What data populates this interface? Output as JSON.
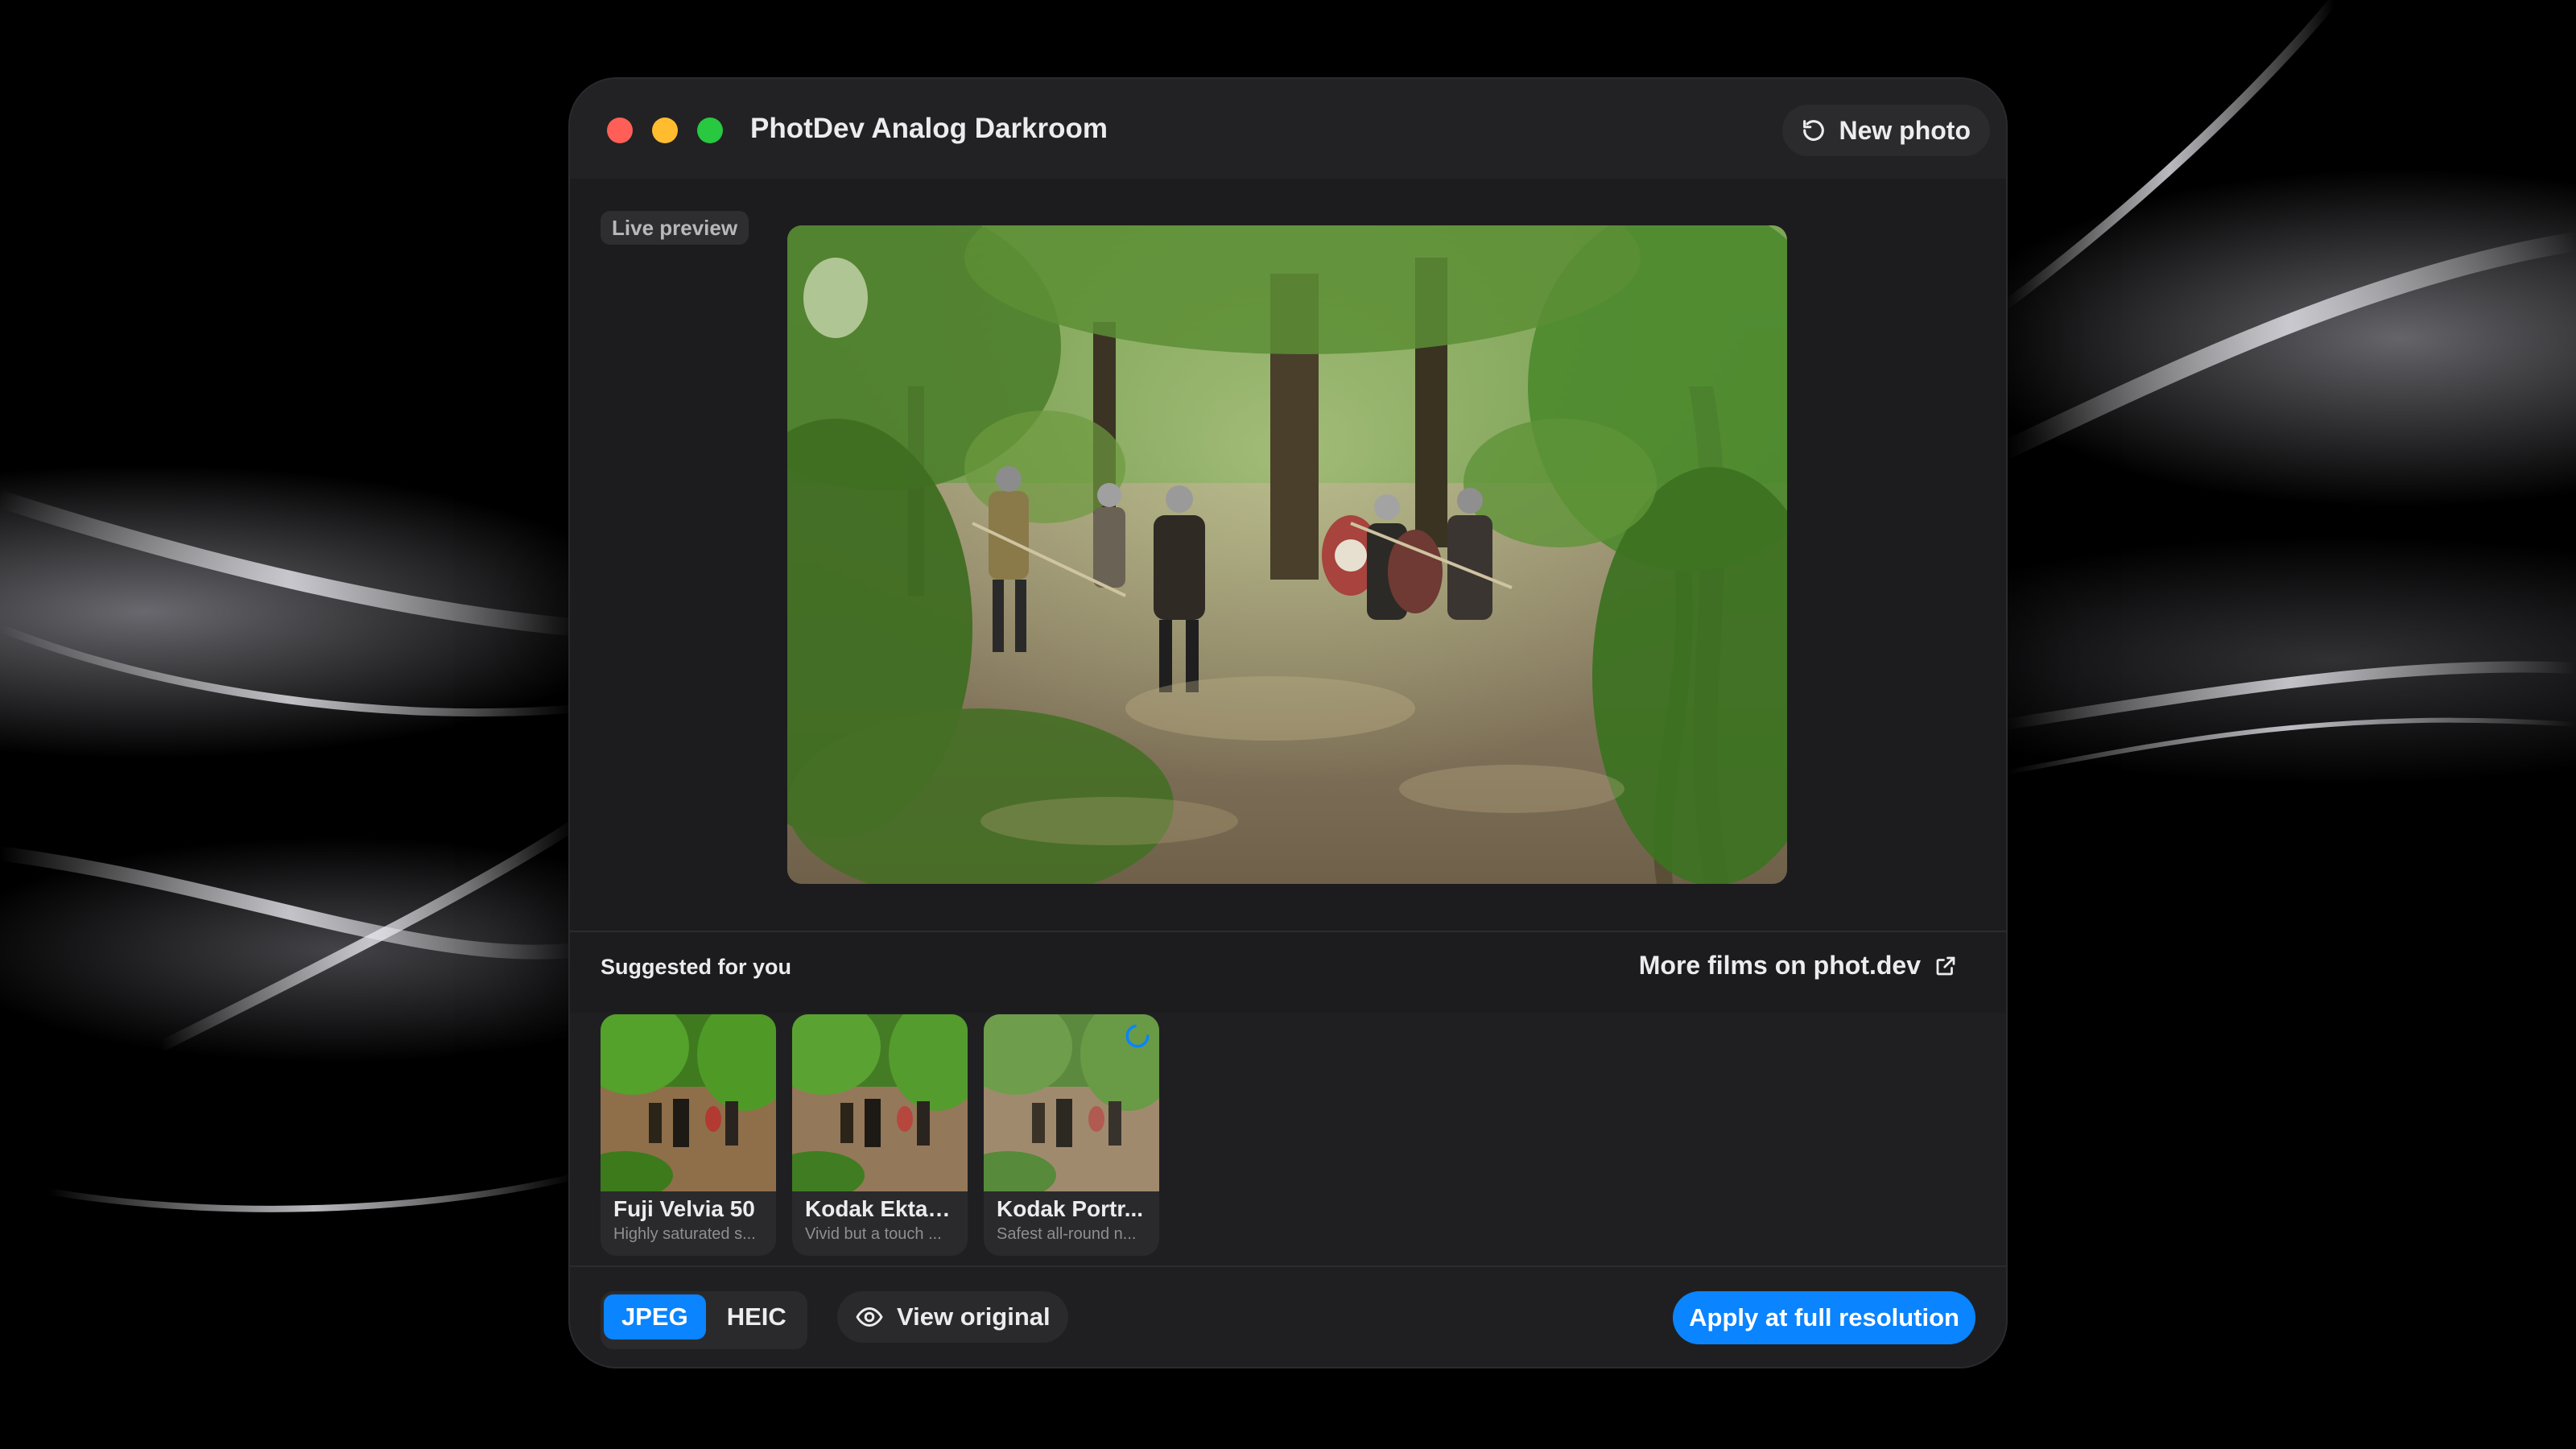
{
  "window": {
    "title": "PhotDev Analog Darkroom",
    "new_photo_label": "New photo",
    "traffic_lights": [
      "close",
      "minimize",
      "zoom"
    ]
  },
  "preview": {
    "badge": "Live preview"
  },
  "suggestions": {
    "heading": "Suggested for you",
    "more_link": "More films on phot.dev",
    "cards": [
      {
        "name": "Fuji Velvia 50",
        "desc": "Highly saturated s...",
        "loading": false
      },
      {
        "name": "Kodak Ektar ...",
        "desc": "Vivid but a touch ...",
        "loading": false
      },
      {
        "name": "Kodak Portr...",
        "desc": "Safest all-round n...",
        "loading": true
      }
    ]
  },
  "footer": {
    "formats": [
      {
        "label": "JPEG",
        "active": true
      },
      {
        "label": "HEIC",
        "active": false
      }
    ],
    "view_original": "View original",
    "apply": "Apply at full resolution"
  },
  "colors": {
    "accent": "#0a84ff",
    "window_bg": "#1f1f22",
    "close": "#ff5f57",
    "minimize": "#febc2e",
    "zoom": "#28c840"
  }
}
